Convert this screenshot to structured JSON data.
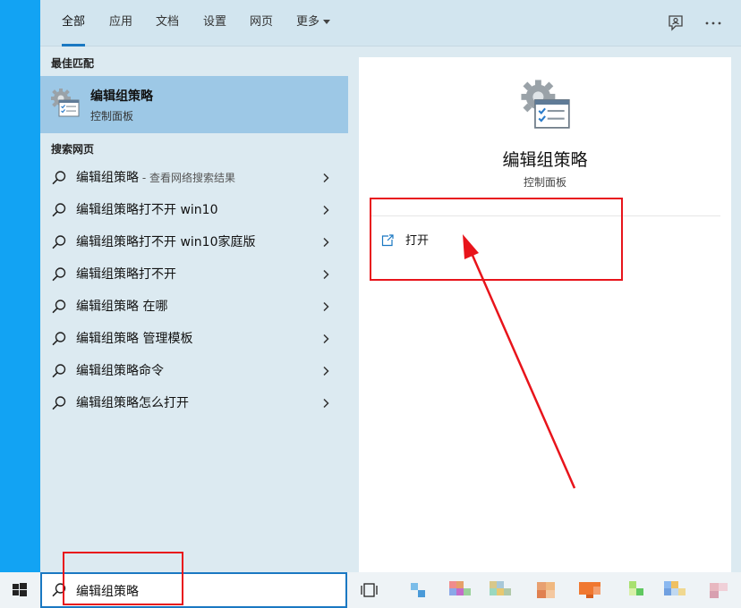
{
  "tabs": [
    {
      "label": "全部"
    },
    {
      "label": "应用"
    },
    {
      "label": "文档"
    },
    {
      "label": "设置"
    },
    {
      "label": "网页"
    },
    {
      "label": "更多"
    }
  ],
  "sections": {
    "best_match": "最佳匹配",
    "search_web": "搜索网页"
  },
  "best_match": {
    "name": "编辑组策略",
    "sub": "控制面板"
  },
  "web_results": [
    {
      "text": "编辑组策略",
      "hint": " - 查看网络搜索结果"
    },
    {
      "text": "编辑组策略打不开 win10",
      "hint": ""
    },
    {
      "text": "编辑组策略打不开 win10家庭版",
      "hint": ""
    },
    {
      "text": "编辑组策略打不开",
      "hint": ""
    },
    {
      "text": "编辑组策略 在哪",
      "hint": ""
    },
    {
      "text": "编辑组策略 管理模板",
      "hint": ""
    },
    {
      "text": "编辑组策略命令",
      "hint": ""
    },
    {
      "text": "编辑组策略怎么打开",
      "hint": ""
    }
  ],
  "detail": {
    "title": "编辑组策略",
    "subtitle": "控制面板",
    "action_label": "打开"
  },
  "search": {
    "value": "编辑组策略"
  },
  "icons": {
    "feedback": "feedback-icon",
    "more": "more-options-icon",
    "search": "search-icon",
    "chevron": "chevron-right-icon",
    "open": "open-icon",
    "start": "windows-start-icon",
    "task_view": "task-view-icon"
  },
  "colors": {
    "accent": "#1a78c2",
    "highlight": "#9dc8e6",
    "annotation": "#e8141b"
  }
}
